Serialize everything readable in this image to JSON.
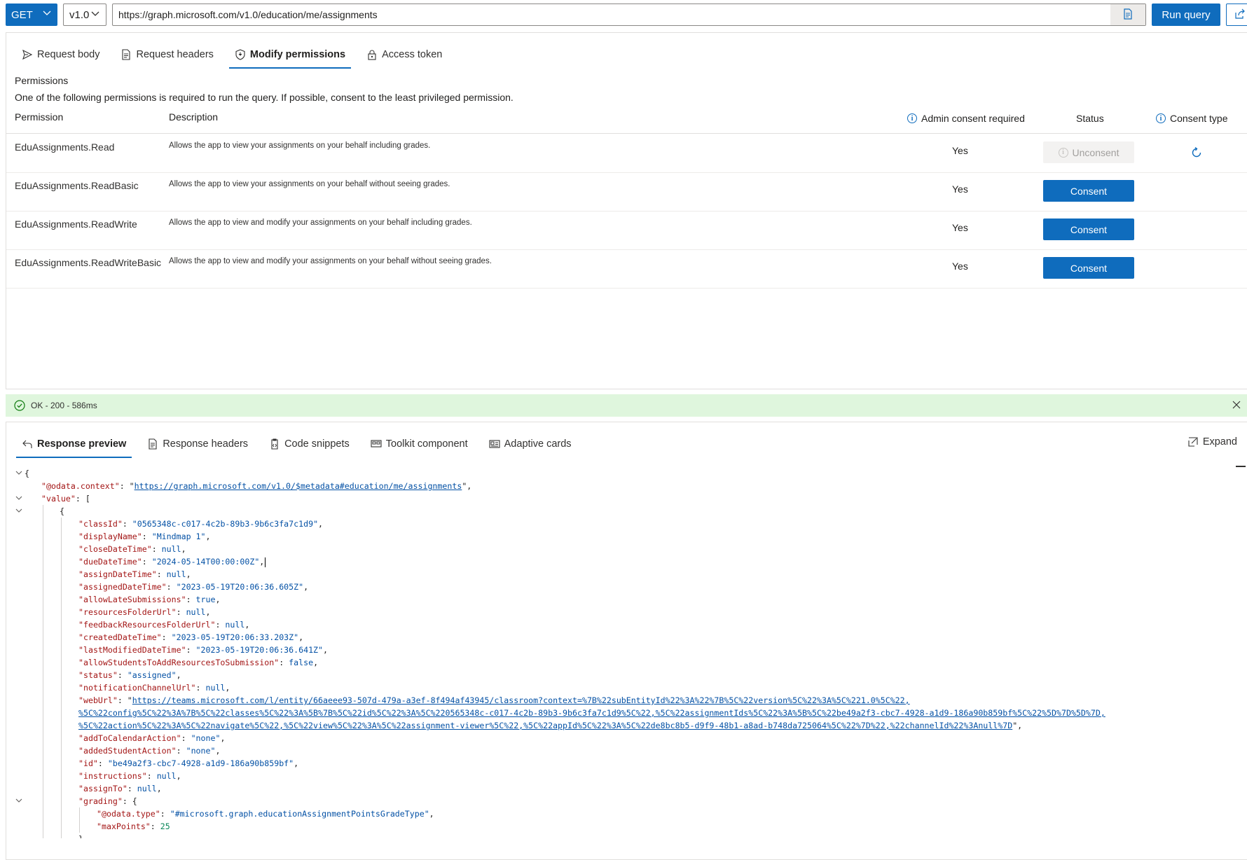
{
  "toolbar": {
    "method": "GET",
    "version": "v1.0",
    "url": "https://graph.microsoft.com/v1.0/education/me/assignments",
    "run_label": "Run query"
  },
  "request": {
    "tabs": [
      {
        "label": "Request body",
        "icon": "send-icon"
      },
      {
        "label": "Request headers",
        "icon": "document-icon"
      },
      {
        "label": "Modify permissions",
        "icon": "shield-icon",
        "active": true
      },
      {
        "label": "Access token",
        "icon": "lock-icon"
      }
    ],
    "permissions_title": "Permissions",
    "permissions_description": "One of the following permissions is required to run the query. If possible, consent to the least privileged permission.",
    "columns": {
      "permission": "Permission",
      "description": "Description",
      "admin": "Admin consent required",
      "status": "Status",
      "consent_type": "Consent type"
    },
    "rows": [
      {
        "name": "EduAssignments.Read",
        "description": "Allows the app to view your assignments on your behalf including grades.",
        "admin": "Yes",
        "action": "Unconsent",
        "enabled": false
      },
      {
        "name": "EduAssignments.ReadBasic",
        "description": "Allows the app to view your assignments on your behalf without seeing grades.",
        "admin": "Yes",
        "action": "Consent",
        "enabled": true
      },
      {
        "name": "EduAssignments.ReadWrite",
        "description": "Allows the app to view and modify your assignments on your behalf including  grades.",
        "admin": "Yes",
        "action": "Consent",
        "enabled": true
      },
      {
        "name": "EduAssignments.ReadWriteBasic",
        "description": "Allows the app to view and modify your assignments on your behalf without seeing grades.",
        "admin": "Yes",
        "action": "Consent",
        "enabled": true
      }
    ]
  },
  "status_bar": {
    "text": "OK - 200 - 586ms",
    "color": "#dff6dd"
  },
  "response": {
    "tabs": [
      {
        "label": "Response preview",
        "icon": "preview-icon",
        "active": true
      },
      {
        "label": "Response headers",
        "icon": "document-icon"
      },
      {
        "label": "Code snippets",
        "icon": "code-icon"
      },
      {
        "label": "Toolkit component",
        "icon": "toolkit-icon"
      },
      {
        "label": "Adaptive cards",
        "icon": "card-icon"
      }
    ],
    "expand_label": "Expand",
    "json": {
      "odata_context": "https://graph.microsoft.com/v1.0/$metadata#education/me/assignments",
      "classId": "0565348c-c017-4c2b-89b3-9b6c3fa7c1d9",
      "displayName": "Mindmap 1",
      "dueDateTime": "2024-05-14T00:00:00Z",
      "assignedDateTime": "2023-05-19T20:06:36.605Z",
      "createdDateTime": "2023-05-19T20:06:33.203Z",
      "lastModifiedDateTime": "2023-05-19T20:06:36.641Z",
      "status": "assigned",
      "webUrl_1": "https://teams.microsoft.com/l/entity/66aeee93-507d-479a-a3ef-8f494af43945/classroom?context=%7B%22subEntityId%22%3A%22%7B%5C%22version%5C%22%3A%5C%221.0%5C%22,",
      "webUrl_2": "%5C%22config%5C%22%3A%7B%5C%22classes%5C%22%3A%5B%7B%5C%22id%5C%22%3A%5C%220565348c-c017-4c2b-89b3-9b6c3fa7c1d9%5C%22,%5C%22assignmentIds%5C%22%3A%5B%5C%22be49a2f3-cbc7-4928-a1d9-186a90b859bf%5C%22%5D%7D%5D%7D,",
      "webUrl_3": "%5C%22action%5C%22%3A%5C%22navigate%5C%22,%5C%22view%5C%22%3A%5C%22assignment-viewer%5C%22,%5C%22appId%5C%22%3A%5C%22de8bc8b5-d9f9-48b1-a8ad-b748da725064%5C%22%7D%22,%22channelId%22%3Anull%7D",
      "addToCalendarAction": "none",
      "addedStudentAction": "none",
      "id": "be49a2f3-cbc7-4928-a1d9-186a90b859bf",
      "grading_type": "#microsoft.graph.educationAssignmentPointsGradeType",
      "maxPoints": "25"
    }
  }
}
